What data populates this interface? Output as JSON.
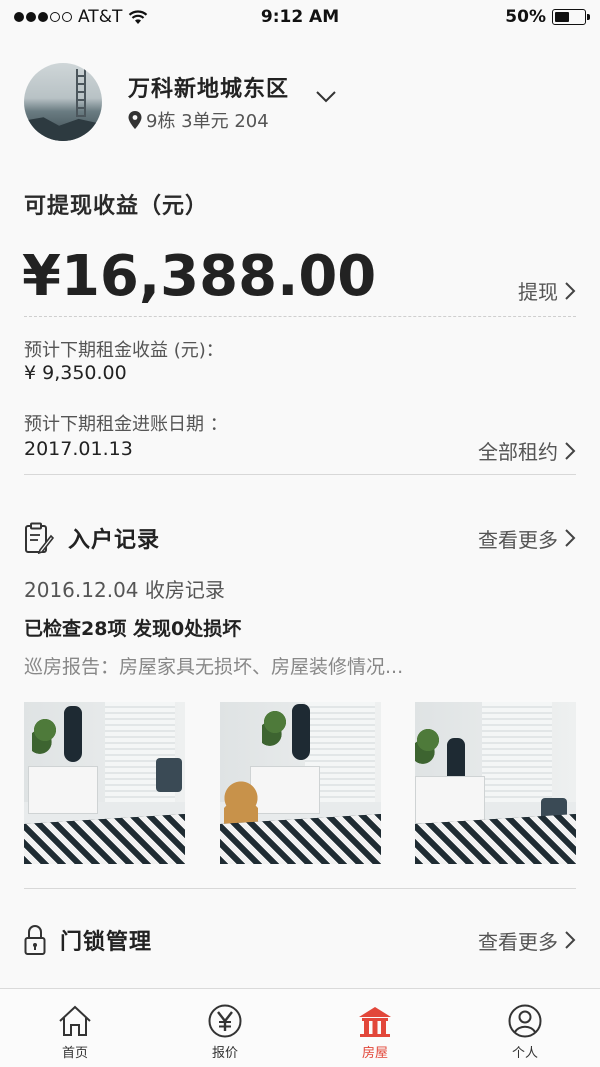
{
  "status_bar": {
    "carrier": "AT&T",
    "time": "9:12 AM",
    "battery": "50%",
    "battery_level": 0.5,
    "signal_dots_filled": 3,
    "signal_dots_total": 5
  },
  "header": {
    "community": "万科新地城东区",
    "address": "9栋 3单元 204"
  },
  "earnings": {
    "title": "可提现收益（元）",
    "amount": "¥16,388.00",
    "withdraw_label": "提现",
    "next_rent_label": "预计下期租金收益 (元)：",
    "next_rent_value": "¥ 9,350.00",
    "next_date_label": "预计下期租金进账日期 ：",
    "next_date_value": "2017.01.13",
    "all_leases_label": "全部租约"
  },
  "checkin": {
    "title": "入户记录",
    "more_label": "查看更多",
    "record_date": "2016.12.04  收房记录",
    "record_summary": "已检查28项 发现0处损坏",
    "record_report": "巡房报告：房屋家具无损坏、房屋装修情况..."
  },
  "lock": {
    "title": "门锁管理",
    "more_label": "查看更多"
  },
  "tabs": [
    {
      "label": "首页",
      "icon": "home-icon"
    },
    {
      "label": "报价",
      "icon": "yen-circle-icon"
    },
    {
      "label": "房屋",
      "icon": "house-icon",
      "active": true
    },
    {
      "label": "个人",
      "icon": "user-icon"
    }
  ],
  "colors": {
    "accent": "#e2473a",
    "text_primary": "#222222",
    "text_secondary": "#555555",
    "background": "#f9f9f9"
  }
}
